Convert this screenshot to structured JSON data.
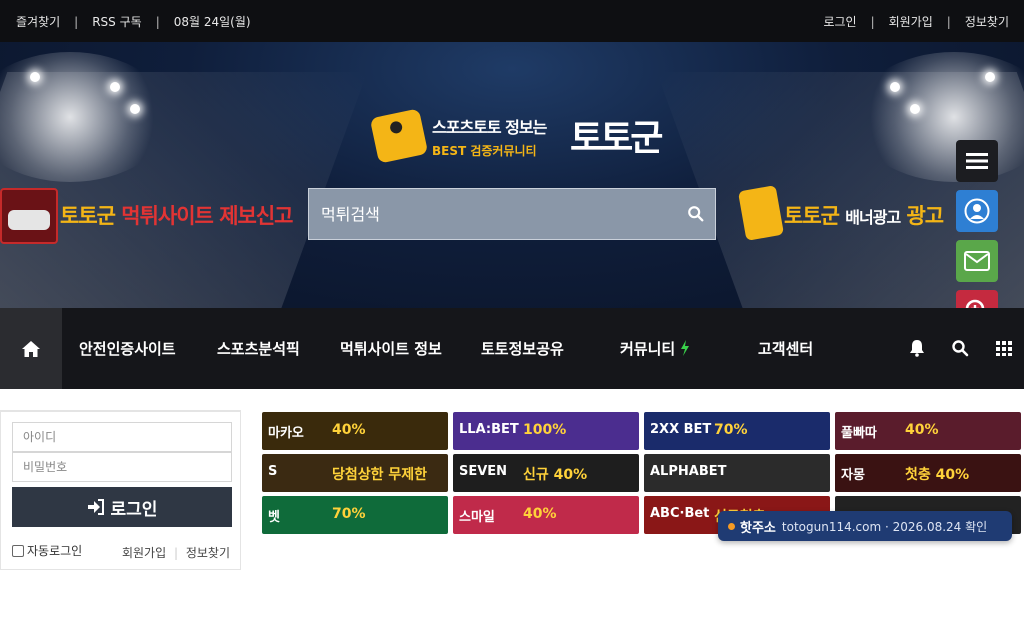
{
  "topbar": {
    "left": [
      "즐겨찾기",
      "RSS 구독",
      "08월 24일(월)"
    ],
    "right": [
      "로그인",
      "회원가입",
      "정보찾기"
    ]
  },
  "logo": {
    "line1": "스포츠토토 정보는",
    "line2": "BEST 검증커뮤니티",
    "big": "토토군"
  },
  "banner_left": {
    "brand": "토토군",
    "text": "먹튀사이트 제보신고"
  },
  "banner_right": {
    "brand": "토토군",
    "text": "배너광고",
    "tail": "광고"
  },
  "search": {
    "placeholder": "먹튀검색"
  },
  "side_buttons": [
    {
      "icon": "menu-icon",
      "color": "#1c1d21"
    },
    {
      "icon": "user-icon",
      "color": "#2e7fd3"
    },
    {
      "icon": "mail-icon",
      "color": "#5aa74a"
    },
    {
      "icon": "zoom-in-icon",
      "color": "#c52a3f"
    }
  ],
  "nav": {
    "items": [
      "안전인증사이트",
      "스포츠분석픽",
      "먹튀사이트 정보",
      "토토정보공유",
      "커뮤니티",
      "고객센터"
    ],
    "icons": [
      "home-icon",
      "bell-icon",
      "search-icon",
      "grid-icon"
    ]
  },
  "login": {
    "id_placeholder": "아이디",
    "pw_placeholder": "비밀번호",
    "submit": "로그인",
    "auto_login": "자동로그인",
    "signup": "회원가입",
    "find": "정보찾기"
  },
  "ads": [
    {
      "name": "마카오",
      "pct": "40%",
      "color": "#3a2a0c"
    },
    {
      "name": "LLA:BET",
      "pct": "100%",
      "color": "#4b2d8f"
    },
    {
      "name": "2XX BET",
      "pct": "70%",
      "color": "#1a2b6b"
    },
    {
      "name": "풀빠따",
      "pct": "40%",
      "color": "#5a1c2c"
    },
    {
      "name": "S",
      "pct": "당첨상한 무제한",
      "color": "#3b2a12"
    },
    {
      "name": "SEVEN",
      "pct": "신규 40%",
      "color": "#1e1e1e"
    },
    {
      "name": "ALPHABET",
      "pct": "",
      "color": "#2b2b2b"
    },
    {
      "name": "자몽",
      "pct": "첫충 40%",
      "color": "#3a1212"
    },
    {
      "name": "벳",
      "pct": "70%",
      "color": "#0f6b3a"
    },
    {
      "name": "스마일",
      "pct": "40%",
      "color": "#c02a4a"
    },
    {
      "name": "ABC·Bet",
      "pct": "신규첫충",
      "color": "#8a1717"
    },
    {
      "name": "",
      "pct": "",
      "color": "#222"
    }
  ],
  "toast": {
    "label": "핫주소",
    "text": "totogun114.com · 2026.08.24 확인"
  }
}
